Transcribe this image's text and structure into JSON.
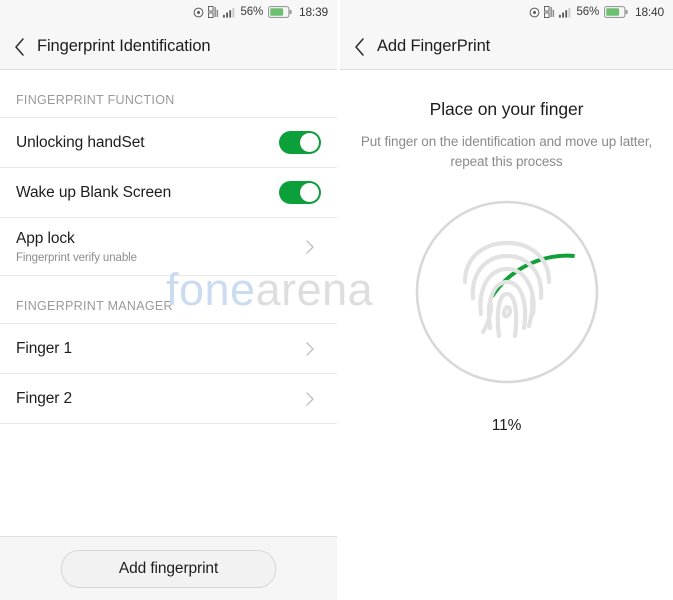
{
  "screens": {
    "left": {
      "statusbar": {
        "icons": [
          "alarm-icon",
          "vpn-icon",
          "signal-icon"
        ],
        "battery_percent": "56%",
        "battery_icon": "battery-icon",
        "time": "18:39"
      },
      "titlebar": {
        "back_icon": "back-chevron-icon",
        "title": "Fingerprint Identification"
      },
      "sections": [
        {
          "header": "FINGERPRINT FUNCTION",
          "rows": [
            {
              "title": "Unlocking handSet",
              "subtitle": "",
              "control": "toggle",
              "toggle_on": true
            },
            {
              "title": "Wake up Blank Screen",
              "subtitle": "",
              "control": "toggle",
              "toggle_on": true
            },
            {
              "title": "App lock",
              "subtitle": "Fingerprint verify unable",
              "control": "chevron",
              "toggle_on": false
            }
          ]
        },
        {
          "header": "FINGERPRINT MANAGER",
          "rows": [
            {
              "title": "Finger 1",
              "subtitle": "",
              "control": "chevron",
              "toggle_on": false
            },
            {
              "title": "Finger 2",
              "subtitle": "",
              "control": "chevron",
              "toggle_on": false
            }
          ]
        }
      ],
      "bottom_button": "Add fingerprint"
    },
    "right": {
      "statusbar": {
        "icons": [
          "alarm-icon",
          "vpn-icon",
          "signal-icon"
        ],
        "battery_percent": "56%",
        "battery_icon": "battery-icon",
        "time": "18:40"
      },
      "titlebar": {
        "back_icon": "back-chevron-icon",
        "title": "Add FingerPrint"
      },
      "enroll": {
        "heading": "Place on your finger",
        "instruction": "Put finger on the identification and move up latter, repeat this process",
        "progress_label": "11%",
        "progress_percent": 11,
        "ring_icon": "fingerprint-icon"
      }
    }
  },
  "watermark": {
    "part_a": "fone",
    "part_b": "arena"
  },
  "colors": {
    "accent_green": "#10a037",
    "toggle_on": "#0ba03a",
    "track_gray": "#d8d8d8",
    "status_bar_bg": "#f7f7f7",
    "text_primary": "#1d1d1d",
    "text_secondary": "#8a8a8a"
  }
}
